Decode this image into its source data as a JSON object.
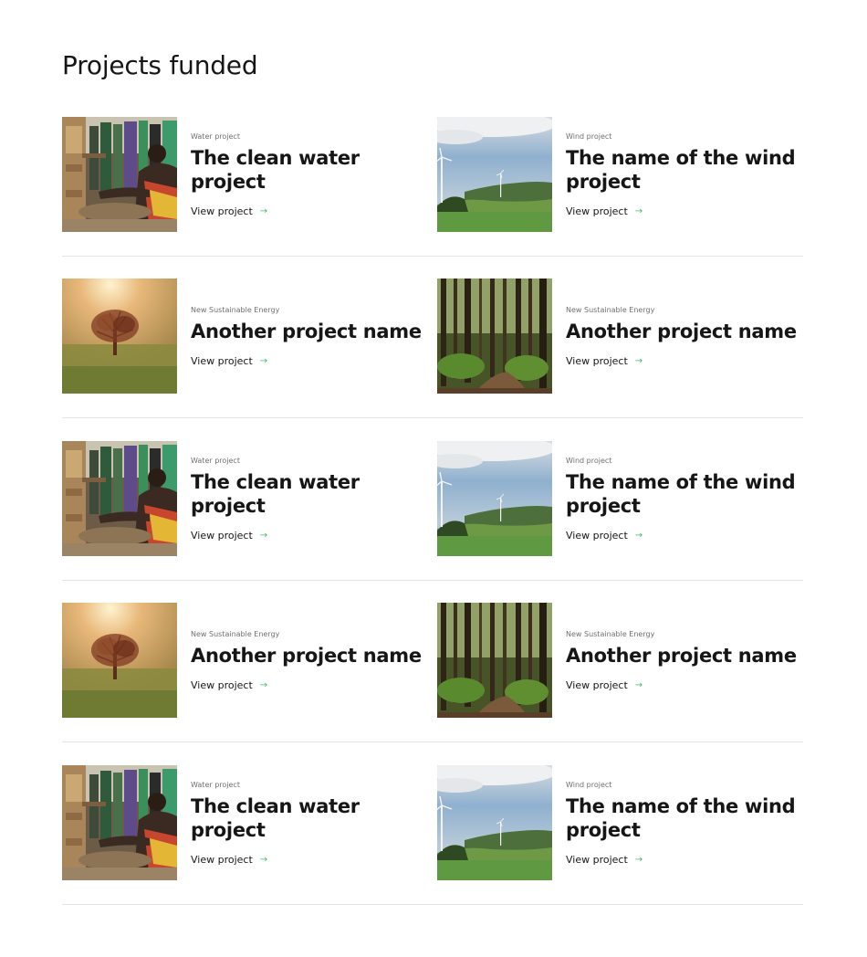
{
  "page": {
    "title": "Projects funded"
  },
  "colors": {
    "link_arrow": "#42be65",
    "divider": "#e4e4e4",
    "text": "#161616",
    "muted": "#6f6f6f"
  },
  "rows": [
    {
      "left": {
        "category": "Water project",
        "name": "The clean water project",
        "link": "View project",
        "image": "water"
      },
      "right": {
        "category": "Wind project",
        "name": "The name of the wind project",
        "link": "View project",
        "image": "wind"
      }
    },
    {
      "left": {
        "category": "New Sustainable Energy",
        "name": "Another project name",
        "link": "View project",
        "image": "tree"
      },
      "right": {
        "category": "New Sustainable Energy",
        "name": "Another project name",
        "link": "View project",
        "image": "forest"
      }
    },
    {
      "left": {
        "category": "Water project",
        "name": "The clean water project",
        "link": "View project",
        "image": "water"
      },
      "right": {
        "category": "Wind project",
        "name": "The name of the wind project",
        "link": "View project",
        "image": "wind"
      }
    },
    {
      "left": {
        "category": "New Sustainable Energy",
        "name": "Another project name",
        "link": "View project",
        "image": "tree"
      },
      "right": {
        "category": "New Sustainable Energy",
        "name": "Another project name",
        "link": "View project",
        "image": "forest"
      }
    },
    {
      "left": {
        "category": "Water project",
        "name": "The clean water project",
        "link": "View project",
        "image": "water"
      },
      "right": {
        "category": "Wind project",
        "name": "The name of the wind project",
        "link": "View project",
        "image": "wind"
      }
    }
  ]
}
